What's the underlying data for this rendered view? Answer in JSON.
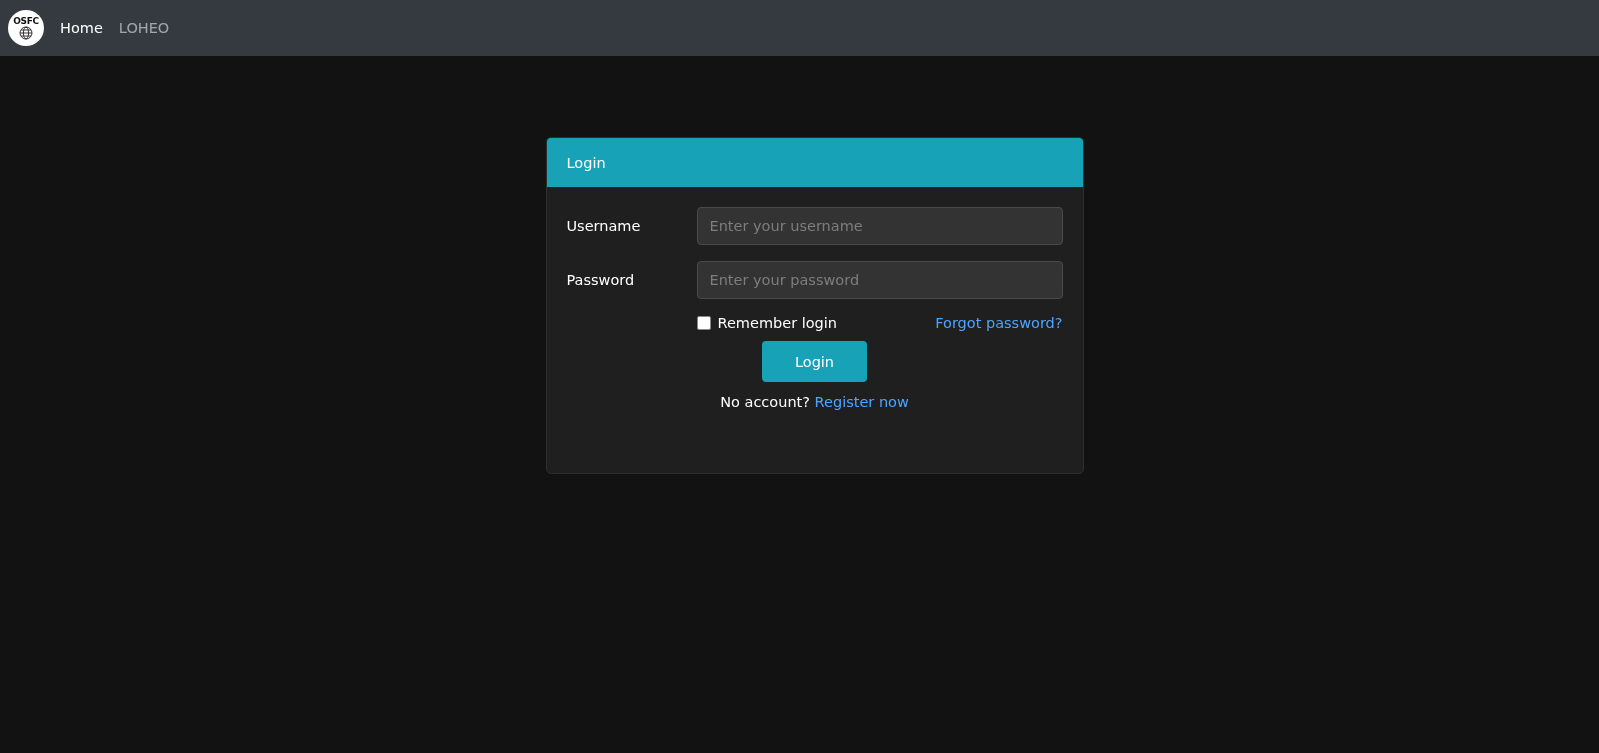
{
  "navbar": {
    "logo_text": "OSFC",
    "links": [
      {
        "label": "Home",
        "selected": true
      },
      {
        "label": "LOHEO",
        "selected": false
      }
    ]
  },
  "login_card": {
    "title": "Login",
    "fields": [
      {
        "label": "Username",
        "placeholder": "Enter your username"
      },
      {
        "label": "Password",
        "placeholder": "Enter your password"
      }
    ],
    "remember": {
      "label": "Remember login",
      "checked": false
    },
    "forgot_link": "Forgot password?",
    "submit": "Login",
    "register": {
      "prompt": "No account?",
      "link": "Register now"
    }
  }
}
